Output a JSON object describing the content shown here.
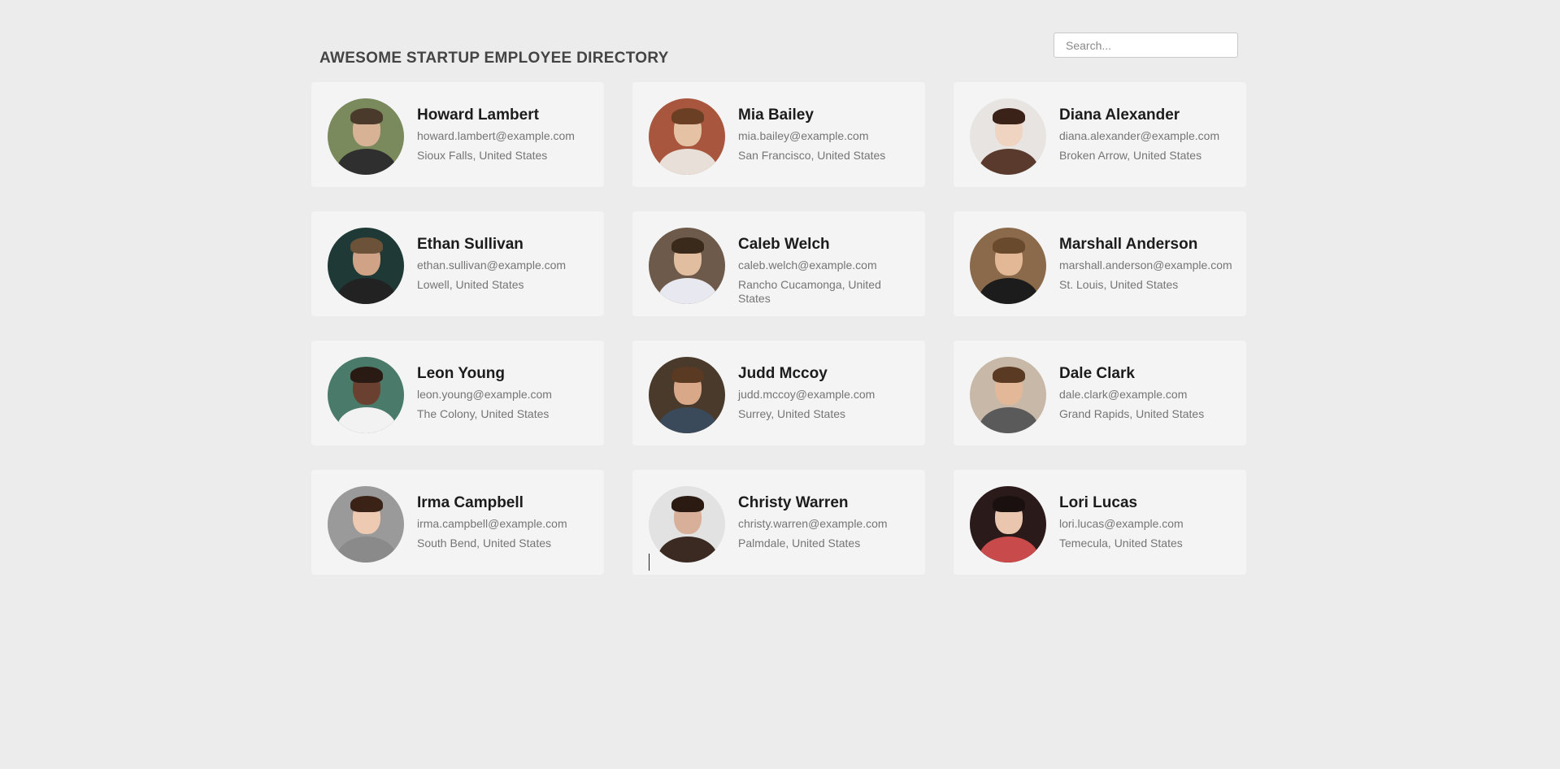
{
  "header": {
    "title": "AWESOME STARTUP EMPLOYEE DIRECTORY",
    "search_placeholder": "Search...",
    "search_value": ""
  },
  "employees": [
    {
      "name": "Howard Lambert",
      "email": "howard.lambert@example.com",
      "location": "Sioux Falls, United States",
      "avatar": {
        "bg": "#7a8a5c",
        "skin": "#d8b294",
        "hair": "#4a3a2c",
        "shirt": "#2f2f2f"
      }
    },
    {
      "name": "Mia Bailey",
      "email": "mia.bailey@example.com",
      "location": "San Francisco, United States",
      "avatar": {
        "bg": "#a8563e",
        "skin": "#e6c2a4",
        "hair": "#6b3f24",
        "shirt": "#e8e0d8"
      }
    },
    {
      "name": "Diana Alexander",
      "email": "diana.alexander@example.com",
      "location": "Broken Arrow, United States",
      "avatar": {
        "bg": "#e8e4e2",
        "skin": "#efd4c2",
        "hair": "#3a2218",
        "shirt": "#5a3a2c"
      }
    },
    {
      "name": "Ethan Sullivan",
      "email": "ethan.sullivan@example.com",
      "location": "Lowell, United States",
      "avatar": {
        "bg": "#1f3a36",
        "skin": "#d0a386",
        "hair": "#6b5238",
        "shirt": "#222222"
      }
    },
    {
      "name": "Caleb Welch",
      "email": "caleb.welch@example.com",
      "location": "Rancho Cucamonga, United States",
      "avatar": {
        "bg": "#6e5a4a",
        "skin": "#e2bea0",
        "hair": "#3a2a1c",
        "shirt": "#e8e8f0"
      }
    },
    {
      "name": "Marshall Anderson",
      "email": "marshall.anderson@example.com",
      "location": "St. Louis, United States",
      "avatar": {
        "bg": "#8a6a4a",
        "skin": "#e2b896",
        "hair": "#6a4a2c",
        "shirt": "#1c1c1c"
      }
    },
    {
      "name": "Leon Young",
      "email": "leon.young@example.com",
      "location": "The Colony, United States",
      "avatar": {
        "bg": "#4a7a6a",
        "skin": "#6a4030",
        "hair": "#2a1a14",
        "shirt": "#f2f2f2"
      }
    },
    {
      "name": "Judd Mccoy",
      "email": "judd.mccoy@example.com",
      "location": "Surrey, United States",
      "avatar": {
        "bg": "#4a3a2c",
        "skin": "#d8a888",
        "hair": "#5a3a22",
        "shirt": "#3a4a5a"
      }
    },
    {
      "name": "Dale Clark",
      "email": "dale.clark@example.com",
      "location": "Grand Rapids, United States",
      "avatar": {
        "bg": "#c8b8a8",
        "skin": "#e2b898",
        "hair": "#5a3a22",
        "shirt": "#5a5a5a"
      }
    },
    {
      "name": "Irma Campbell",
      "email": "irma.campbell@example.com",
      "location": "South Bend, United States",
      "avatar": {
        "bg": "#9a9a9a",
        "skin": "#eecab2",
        "hair": "#3a2216",
        "shirt": "#8a8a8a"
      }
    },
    {
      "name": "Christy Warren",
      "email": "christy.warren@example.com",
      "location": "Palmdale, United States",
      "avatar": {
        "bg": "#e2e2e2",
        "skin": "#d8b09a",
        "hair": "#2a1a12",
        "shirt": "#3a2a22"
      }
    },
    {
      "name": "Lori Lucas",
      "email": "lori.lucas@example.com",
      "location": "Temecula, United States",
      "avatar": {
        "bg": "#2a1a1a",
        "skin": "#eac6ae",
        "hair": "#1a1010",
        "shirt": "#c84a4a"
      }
    }
  ]
}
